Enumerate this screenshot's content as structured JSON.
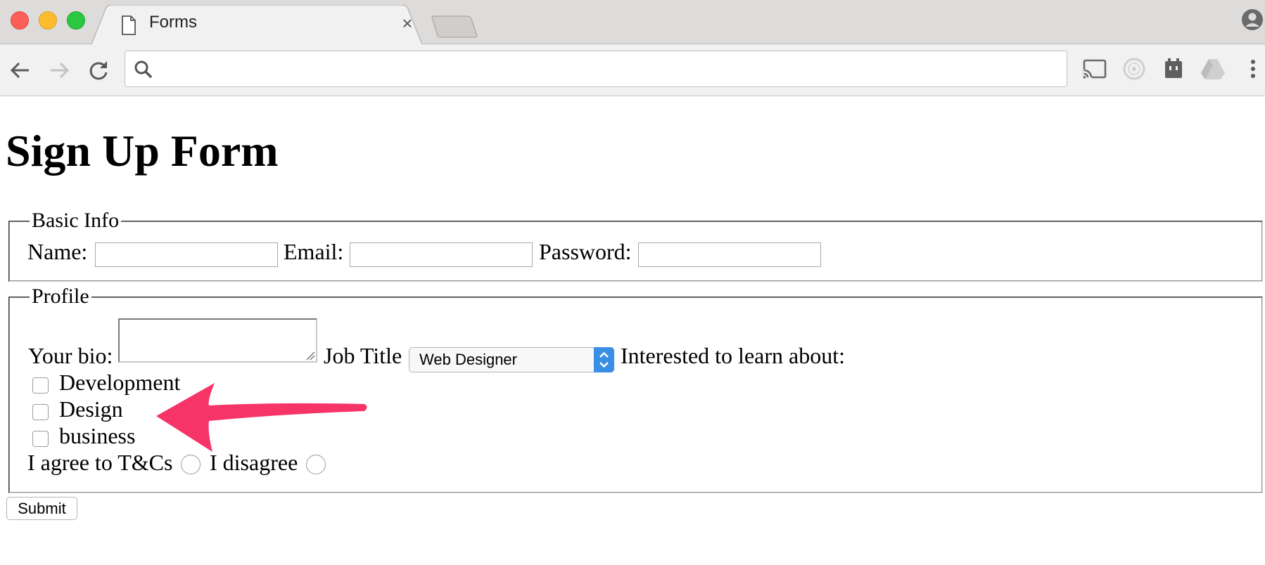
{
  "browser": {
    "tab_title": "Forms",
    "tab_close": "×",
    "address_value": "",
    "colors": {
      "close": "#fc5f57",
      "minimize": "#fdbc2e",
      "maximize": "#29c840"
    }
  },
  "page": {
    "heading": "Sign Up Form",
    "basic_info": {
      "legend": "Basic Info",
      "name_label": "Name:",
      "name_value": "",
      "email_label": "Email:",
      "email_value": "",
      "password_label": "Password:",
      "password_value": ""
    },
    "profile": {
      "legend": "Profile",
      "bio_label": "Your bio:",
      "job_title_label": "Job Title",
      "job_title_selected": "Web Designer",
      "interests_label": "Interested to learn about:",
      "interests": [
        {
          "label": "Development",
          "checked": false
        },
        {
          "label": "Design",
          "checked": false
        },
        {
          "label": "business",
          "checked": false
        }
      ],
      "agree_label": "I agree to T&Cs",
      "disagree_label": "I disagree"
    },
    "submit_label": "Submit"
  },
  "annotation": {
    "arrow_color": "#f73468",
    "target": "Design"
  }
}
